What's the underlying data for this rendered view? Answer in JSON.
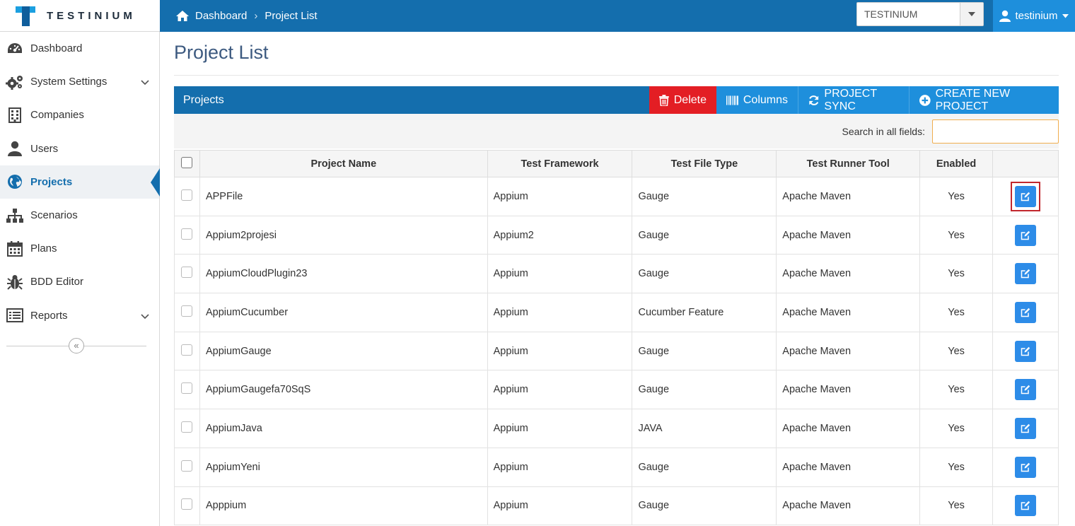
{
  "app": {
    "logo_text": "TESTINIUM"
  },
  "breadcrumb": {
    "items": [
      "Dashboard",
      "Project List"
    ],
    "separator": "›"
  },
  "company_select": {
    "value": "TESTINIUM"
  },
  "user_menu": {
    "name": "testinium"
  },
  "sidebar": {
    "items": [
      {
        "label": "Dashboard",
        "icon": "dashboard-gauge-icon"
      },
      {
        "label": "System Settings",
        "icon": "gears-icon",
        "has_submenu": true
      },
      {
        "label": "Companies",
        "icon": "building-icon"
      },
      {
        "label": "Users",
        "icon": "user-icon"
      },
      {
        "label": "Projects",
        "icon": "globe-icon",
        "active": true
      },
      {
        "label": "Scenarios",
        "icon": "sitemap-icon"
      },
      {
        "label": "Plans",
        "icon": "calendar-icon"
      },
      {
        "label": "BDD Editor",
        "icon": "bug-icon"
      },
      {
        "label": "Reports",
        "icon": "list-icon",
        "has_submenu": true
      }
    ],
    "collapse_glyph": "«"
  },
  "page": {
    "title": "Project List"
  },
  "panel": {
    "title": "Projects",
    "buttons": {
      "delete": "Delete",
      "columns": "Columns",
      "sync": "PROJECT SYNC",
      "create": "CREATE NEW PROJECT"
    }
  },
  "search": {
    "label": "Search in all fields:",
    "value": ""
  },
  "table": {
    "columns": [
      "Project Name",
      "Test Framework",
      "Test File Type",
      "Test Runner Tool",
      "Enabled"
    ],
    "rows": [
      [
        "APPFile",
        "Appium",
        "Gauge",
        "Apache Maven",
        "Yes"
      ],
      [
        "Appium2projesi",
        "Appium2",
        "Gauge",
        "Apache Maven",
        "Yes"
      ],
      [
        "AppiumCloudPlugin23",
        "Appium",
        "Gauge",
        "Apache Maven",
        "Yes"
      ],
      [
        "AppiumCucumber",
        "Appium",
        "Cucumber Feature",
        "Apache Maven",
        "Yes"
      ],
      [
        "AppiumGauge",
        "Appium",
        "Gauge",
        "Apache Maven",
        "Yes"
      ],
      [
        "AppiumGaugefa70SqS",
        "Appium",
        "Gauge",
        "Apache Maven",
        "Yes"
      ],
      [
        "AppiumJava",
        "Appium",
        "JAVA",
        "Apache Maven",
        "Yes"
      ],
      [
        "AppiumYeni",
        "Appium",
        "Gauge",
        "Apache Maven",
        "Yes"
      ],
      [
        "Apppium",
        "Appium",
        "Gauge",
        "Apache Maven",
        "Yes"
      ]
    ]
  },
  "colors": {
    "primary": "#146ead",
    "accent": "#1e8fdc",
    "danger": "#e31e24",
    "highlight": "#c1272d"
  }
}
